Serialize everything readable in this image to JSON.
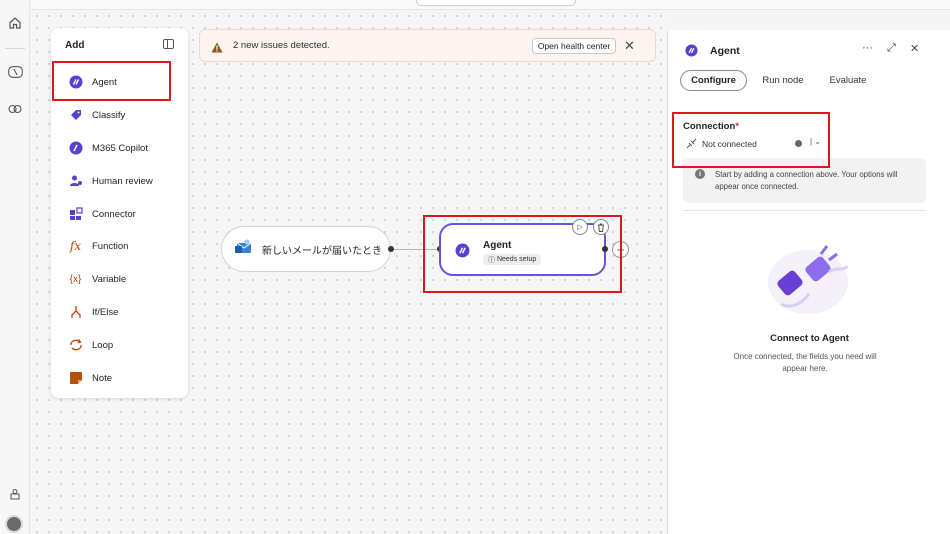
{
  "add_panel": {
    "title": "Add",
    "items": [
      {
        "label": "Agent",
        "icon": "agent-icon"
      },
      {
        "label": "Classify",
        "icon": "classify-icon"
      },
      {
        "label": "M365 Copilot",
        "icon": "copilot-icon"
      },
      {
        "label": "Human review",
        "icon": "human-review-icon"
      },
      {
        "label": "Connector",
        "icon": "connector-icon"
      },
      {
        "label": "Function",
        "icon": "function-icon"
      },
      {
        "label": "Variable",
        "icon": "variable-icon"
      },
      {
        "label": "If/Else",
        "icon": "branch-icon"
      },
      {
        "label": "Loop",
        "icon": "loop-icon"
      },
      {
        "label": "Note",
        "icon": "note-icon"
      }
    ]
  },
  "notification": {
    "message": "2 new issues detected.",
    "button": "Open health center"
  },
  "canvas": {
    "trigger_label": "新しいメールが届いたとき",
    "agent_node": {
      "title": "Agent",
      "badge": "Needs setup"
    }
  },
  "right_panel": {
    "title": "Agent",
    "tabs": [
      {
        "label": "Configure",
        "active": true
      },
      {
        "label": "Run node",
        "active": false
      },
      {
        "label": "Evaluate",
        "active": false
      }
    ],
    "connection": {
      "label": "Connection",
      "required_mark": "*",
      "value": "Not connected"
    },
    "info_text": "Start by adding a connection above. Your options will appear once connected.",
    "empty_title": "Connect to Agent",
    "empty_sub": "Once connected, the fields you need will appear here."
  },
  "colors": {
    "accent": "#6a55d8",
    "highlight": "#e0161e",
    "warning_bg": "#fdf3ef"
  }
}
